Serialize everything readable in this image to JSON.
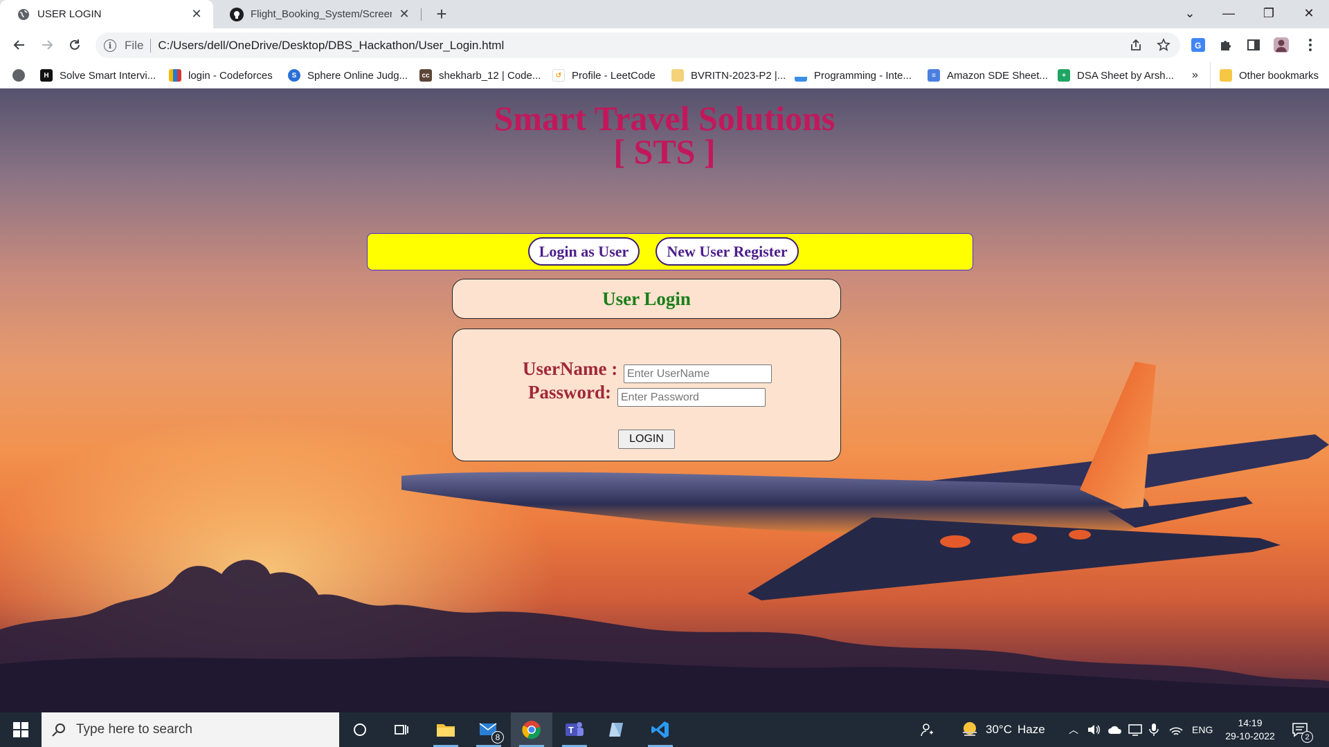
{
  "browser": {
    "tabs": [
      {
        "title": "USER LOGIN",
        "active": true,
        "icon": "globe-icon"
      },
      {
        "title": "Flight_Booking_System/ScreenSh",
        "active": false,
        "icon": "github-icon"
      }
    ],
    "address": {
      "scheme_label": "File",
      "url": "C:/Users/dell/OneDrive/Desktop/DBS_Hackathon/User_Login.html"
    },
    "bookmarks": [
      {
        "label": "",
        "icon": "globe-icon"
      },
      {
        "label": "Solve Smart Intervi...",
        "icon": "hackerrank-icon"
      },
      {
        "label": "login - Codeforces",
        "icon": "codeforces-icon"
      },
      {
        "label": "Sphere Online Judg...",
        "icon": "spoj-icon"
      },
      {
        "label": "shekharb_12 | Code...",
        "icon": "codechef-icon"
      },
      {
        "label": "Profile - LeetCode",
        "icon": "leetcode-icon"
      },
      {
        "label": "BVRITN-2023-P2 |...",
        "icon": "trophy-icon"
      },
      {
        "label": "Programming - Inte...",
        "icon": "chart-icon"
      },
      {
        "label": "Amazon SDE Sheet...",
        "icon": "doc-icon"
      },
      {
        "label": "DSA Sheet by Arsh...",
        "icon": "sheet-icon"
      }
    ],
    "bookmarks_overflow": "»",
    "other_bookmarks": "Other bookmarks"
  },
  "page": {
    "title_line1": "Smart Travel Solutions",
    "title_line2": "[ STS ]",
    "nav": {
      "login_label": "Login as User",
      "register_label": "New User Register"
    },
    "section_heading": "User Login",
    "form": {
      "username_label": "UserName :",
      "username_placeholder": "Enter UserName",
      "password_label": "Password:",
      "password_placeholder": "Enter Password",
      "submit_label": "LOGIN"
    },
    "colors": {
      "title": "#c2185b",
      "nav_strip": "#ffff00",
      "heading": "#1b7e1b",
      "labels": "#a0283a",
      "panel_bg": "#fde3cf"
    }
  },
  "taskbar": {
    "search_placeholder": "Type here to search",
    "mail_badge": "8",
    "weather": {
      "temp": "30°C",
      "condition": "Haze"
    },
    "language": "ENG",
    "time": "14:19",
    "date": "29-10-2022",
    "notification_count": "2"
  }
}
